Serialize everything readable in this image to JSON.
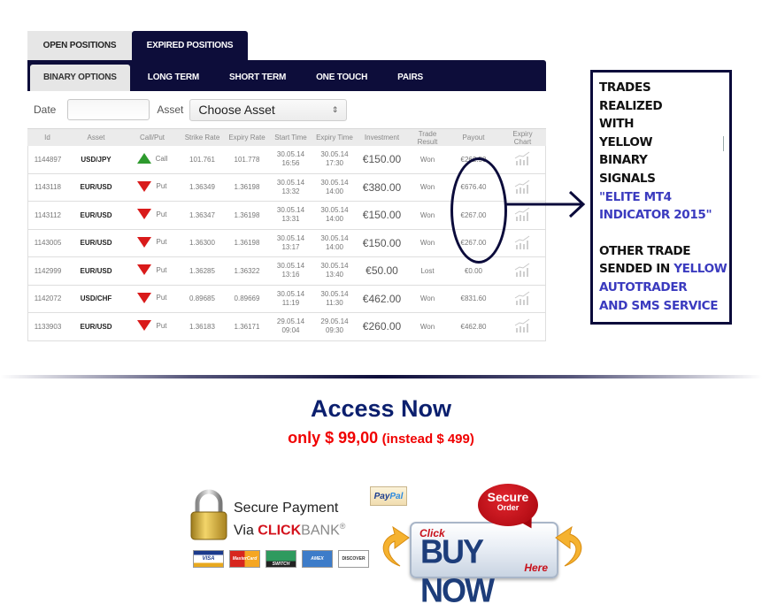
{
  "top_tabs": [
    {
      "label": "OPEN POSITIONS",
      "active": false
    },
    {
      "label": "EXPIRED POSITIONS",
      "active": true
    }
  ],
  "sub_tabs": [
    {
      "label": "BINARY OPTIONS",
      "active": true
    },
    {
      "label": "LONG TERM",
      "active": false
    },
    {
      "label": "SHORT TERM",
      "active": false
    },
    {
      "label": "ONE TOUCH",
      "active": false
    },
    {
      "label": "PAIRS",
      "active": false
    }
  ],
  "filters": {
    "date_label": "Date",
    "date_value": "",
    "asset_label": "Asset",
    "asset_selected": "Choose Asset"
  },
  "table": {
    "headers": [
      "Id",
      "Asset",
      "Call/Put",
      "Strike Rate",
      "Expiry Rate",
      "Start Time",
      "Expiry Time",
      "Investment",
      "Trade Result",
      "Payout",
      "Expiry Chart"
    ],
    "rows": [
      {
        "id": "1144897",
        "asset": "USD/JPY",
        "direction": "Call",
        "strike": "101.761",
        "expiry_rate": "101.778",
        "start_date": "30.05.14",
        "start_time": "16:56",
        "expiry_date": "30.05.14",
        "expiry_time": "17:30",
        "investment": "€150.00",
        "result": "Won",
        "payout": "€262.50"
      },
      {
        "id": "1143118",
        "asset": "EUR/USD",
        "direction": "Put",
        "strike": "1.36349",
        "expiry_rate": "1.36198",
        "start_date": "30.05.14",
        "start_time": "13:32",
        "expiry_date": "30.05.14",
        "expiry_time": "14:00",
        "investment": "€380.00",
        "result": "Won",
        "payout": "€676.40"
      },
      {
        "id": "1143112",
        "asset": "EUR/USD",
        "direction": "Put",
        "strike": "1.36347",
        "expiry_rate": "1.36198",
        "start_date": "30.05.14",
        "start_time": "13:31",
        "expiry_date": "30.05.14",
        "expiry_time": "14:00",
        "investment": "€150.00",
        "result": "Won",
        "payout": "€267.00"
      },
      {
        "id": "1143005",
        "asset": "EUR/USD",
        "direction": "Put",
        "strike": "1.36300",
        "expiry_rate": "1.36198",
        "start_date": "30.05.14",
        "start_time": "13:17",
        "expiry_date": "30.05.14",
        "expiry_time": "14:00",
        "investment": "€150.00",
        "result": "Won",
        "payout": "€267.00"
      },
      {
        "id": "1142999",
        "asset": "EUR/USD",
        "direction": "Put",
        "strike": "1.36285",
        "expiry_rate": "1.36322",
        "start_date": "30.05.14",
        "start_time": "13:16",
        "expiry_date": "30.05.14",
        "expiry_time": "13:40",
        "investment": "€50.00",
        "result": "Lost",
        "payout": "€0.00"
      },
      {
        "id": "1142072",
        "asset": "USD/CHF",
        "direction": "Put",
        "strike": "0.89685",
        "expiry_rate": "0.89669",
        "start_date": "30.05.14",
        "start_time": "11:19",
        "expiry_date": "30.05.14",
        "expiry_time": "11:30",
        "investment": "€462.00",
        "result": "Won",
        "payout": "€831.60"
      },
      {
        "id": "1133903",
        "asset": "EUR/USD",
        "direction": "Put",
        "strike": "1.36183",
        "expiry_rate": "1.36171",
        "start_date": "29.05.14",
        "start_time": "09:04",
        "expiry_date": "29.05.14",
        "expiry_time": "09:30",
        "investment": "€260.00",
        "result": "Won",
        "payout": "€462.80"
      }
    ]
  },
  "note": {
    "lines_black_1": [
      "TRADES",
      "REALIZED",
      "WITH",
      "YELLOW",
      "BINARY",
      "SIGNALS"
    ],
    "lines_blue_1": [
      "\"ELITE MT4",
      "INDICATOR 2015\""
    ],
    "line_mixed_a": "OTHER TRADE",
    "line_mixed_b_black": "SENDED IN ",
    "line_mixed_b_blue": "YELLOW",
    "lines_blue_2": [
      "AUTOTRADER",
      "AND SMS SERVICE"
    ]
  },
  "cta": {
    "title": "Access Now",
    "price_main": "only $ 99,00",
    "price_note": "(instead $ 499)"
  },
  "payment": {
    "secure_line1": "Secure Payment",
    "secure_via": "Via ",
    "clickbank_red": "CLICK",
    "clickbank_gray": "BANK",
    "registered": "®",
    "paypal_a": "Pay",
    "paypal_b": "Pal",
    "cards": [
      "VISA",
      "MasterCard",
      "SWITCH",
      "AMEX",
      "DISCOVER"
    ]
  },
  "buy": {
    "click": "Click",
    "main": "BUY NOW",
    "here": "Here",
    "bubble_1": "Secure",
    "bubble_2": "Order"
  },
  "colors": {
    "navy": "#0d0d3a",
    "call_green": "#2e9a2e",
    "put_red": "#d91a1a",
    "cta_blue": "#0b1f6e",
    "price_red": "#f00000",
    "note_blue": "#3b3bbf"
  }
}
